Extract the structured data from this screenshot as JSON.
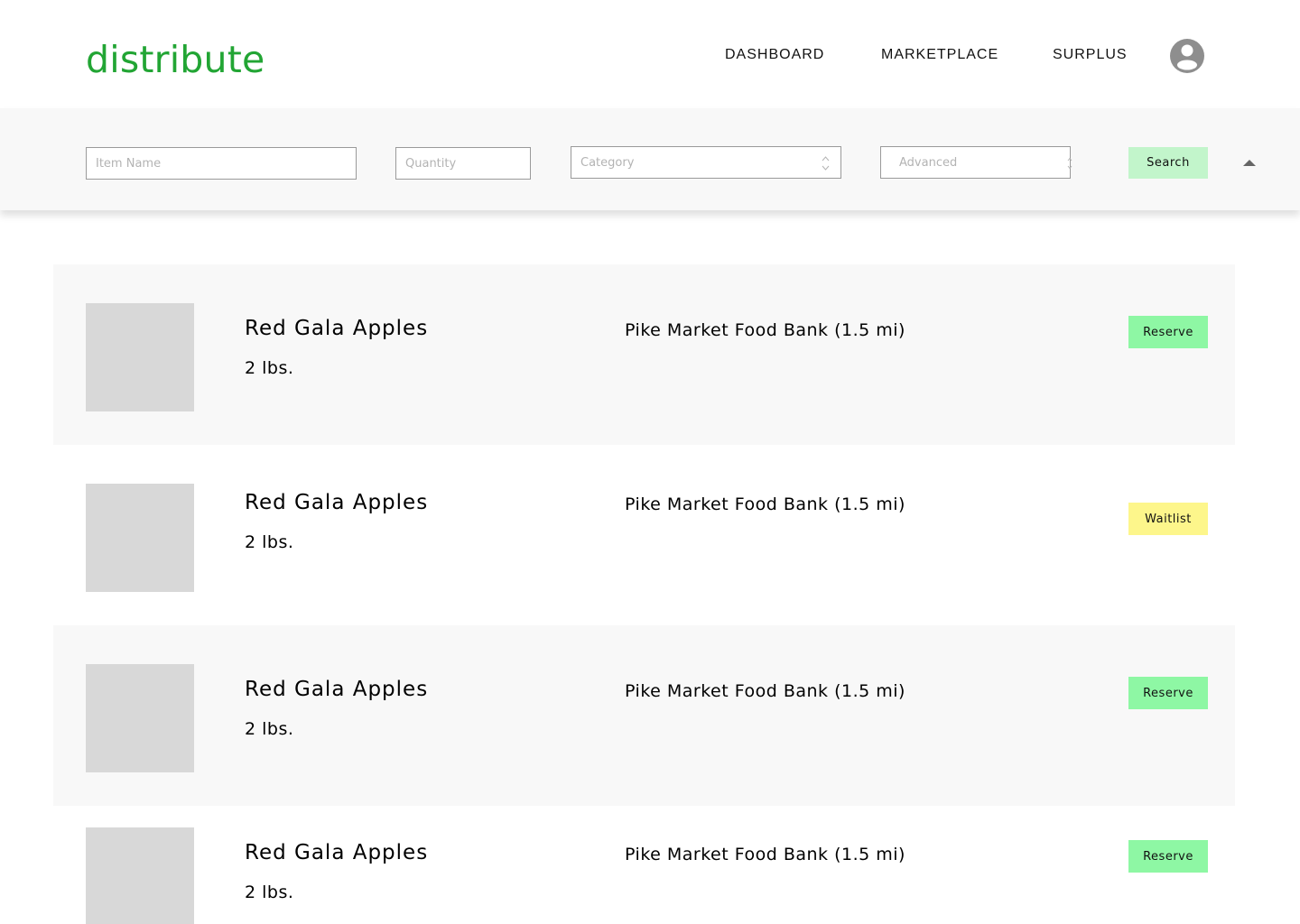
{
  "header": {
    "logo": "distribute",
    "nav": {
      "dashboard": "DASHBOARD",
      "marketplace": "MARKETPLACE",
      "surplus": "SURPLUS"
    }
  },
  "search": {
    "item_name_placeholder": "Item Name",
    "quantity_placeholder": "Quantity",
    "category_placeholder": "Category",
    "advanced_placeholder": "Advanced",
    "search_label": "Search"
  },
  "colors": {
    "brand": "#22a534",
    "reserve": "#8ef7a4",
    "waitlist": "#fdf68b",
    "search_button": "#c2f5cb",
    "placeholder_image": "#d8d8d8"
  },
  "listings": [
    {
      "name": "Red Gala Apples",
      "quantity": "2 lbs.",
      "location": "Pike Market Food Bank (1.5 mi)",
      "action": "Reserve"
    },
    {
      "name": "Red Gala Apples",
      "quantity": "2 lbs.",
      "location": "Pike Market Food Bank (1.5 mi)",
      "action": "Waitlist"
    },
    {
      "name": "Red Gala Apples",
      "quantity": "2 lbs.",
      "location": "Pike Market Food Bank (1.5 mi)",
      "action": "Reserve"
    },
    {
      "name": "Red Gala Apples",
      "quantity": "2 lbs.",
      "location": "Pike Market Food Bank (1.5 mi)",
      "action": "Reserve"
    }
  ]
}
